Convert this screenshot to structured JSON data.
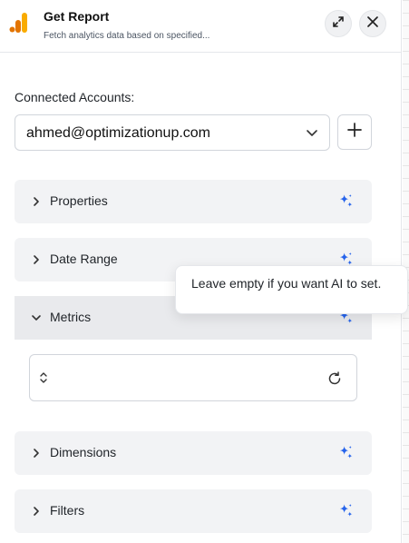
{
  "header": {
    "title": "Get Report",
    "subtitle": "Fetch analytics data based on specified...",
    "logo_icon": "google-analytics-logo",
    "colors": {
      "logo_orange": "#f9ab00",
      "logo_dark": "#e37400"
    }
  },
  "accounts": {
    "label": "Connected Accounts:",
    "selected": "ahmed@optimizationup.com"
  },
  "sections": [
    {
      "title": "Properties",
      "expanded": false
    },
    {
      "title": "Date Range",
      "expanded": false
    },
    {
      "title": "Metrics",
      "expanded": true
    },
    {
      "title": "Dimensions",
      "expanded": false
    },
    {
      "title": "Filters",
      "expanded": false
    }
  ],
  "tooltip": {
    "text": "Leave empty if you want AI to set."
  },
  "colors": {
    "sparkle_blue": "#2563eb",
    "section_bg": "#f2f3f5",
    "border": "#d1d5db"
  }
}
